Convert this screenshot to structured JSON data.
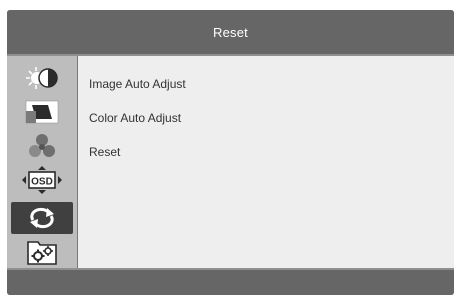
{
  "header": {
    "title": "Reset"
  },
  "sidebar": {
    "items": [
      {
        "icon": "brightness-contrast-icon"
      },
      {
        "icon": "image-setup-icon"
      },
      {
        "icon": "color-setup-icon"
      },
      {
        "icon": "osd-setup-icon",
        "label": "OSD"
      },
      {
        "icon": "reset-icon",
        "active": true
      },
      {
        "icon": "extra-settings-icon"
      }
    ]
  },
  "main": {
    "items": [
      {
        "label": "Image Auto Adjust"
      },
      {
        "label": "Color Auto Adjust"
      },
      {
        "label": "Reset"
      }
    ]
  },
  "colors": {
    "header_bg": "#666666",
    "sidebar_bg": "#bdbdbd",
    "content_bg": "#eeeeee",
    "active_bg": "#404040"
  }
}
